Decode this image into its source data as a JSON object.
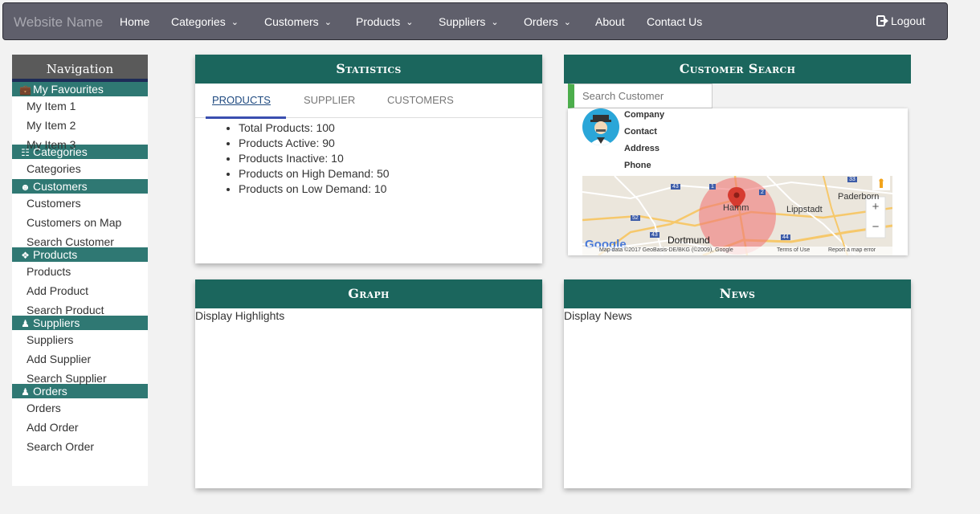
{
  "navbar": {
    "brand": "Website Name",
    "items": [
      "Home",
      "Categories",
      "Customers",
      "Products",
      "Suppliers",
      "Orders",
      "About",
      "Contact Us"
    ],
    "logout": "Logout"
  },
  "sidebar": {
    "title": "Navigation",
    "sections": {
      "favourites": {
        "label": "My Favourites",
        "items": [
          "My Item 1",
          "My Item 2",
          "My Item 3"
        ]
      },
      "categories": {
        "label": "Categories",
        "items": [
          "Categories"
        ]
      },
      "customers": {
        "label": "Customers",
        "items": [
          "Customers",
          "Customers on Map",
          "Search Customer"
        ]
      },
      "products": {
        "label": "Products",
        "items": [
          "Products",
          "Add Product",
          "Search Product"
        ]
      },
      "suppliers": {
        "label": "Suppliers",
        "items": [
          "Suppliers",
          "Add Supplier",
          "Search Supplier"
        ]
      },
      "orders": {
        "label": "Orders",
        "items": [
          "Orders",
          "Add Order",
          "Search Order"
        ]
      }
    }
  },
  "statistics": {
    "title": "Statistics",
    "tabs": [
      "PRODUCTS",
      "SUPPLIER",
      "CUSTOMERS"
    ],
    "active_tab": "PRODUCTS",
    "lines": [
      "Total Products: 100",
      "Products Active: 90",
      "Products Inactive: 10",
      "Products on High Demand: 50",
      "Products on Low Demand: 10"
    ]
  },
  "customer_search": {
    "title": "Customer Search",
    "placeholder": "Search Customer",
    "fields": [
      "Company",
      "Contact",
      "Address",
      "Phone"
    ],
    "map": {
      "cities": [
        "Hamm",
        "Lippstadt",
        "Paderborn",
        "Dortmund"
      ],
      "road_badges": [
        "43",
        "1",
        "2",
        "52",
        "43",
        "44",
        "33"
      ],
      "google": "Google",
      "attribution": "Map data ©2017 GeoBasis-DE/BKG (©2009), Google",
      "terms": "Terms of Use",
      "report": "Report a map error",
      "zoom_in": "+",
      "zoom_out": "−"
    }
  },
  "graph": {
    "title": "Graph",
    "body": "Display Highlights"
  },
  "news": {
    "title": "News",
    "body": "Display News"
  },
  "colors": {
    "panel_header": "#1b665d",
    "section_header": "#2f7873",
    "navbar": "#5f5f6b",
    "accent_green": "#4cae4c"
  }
}
